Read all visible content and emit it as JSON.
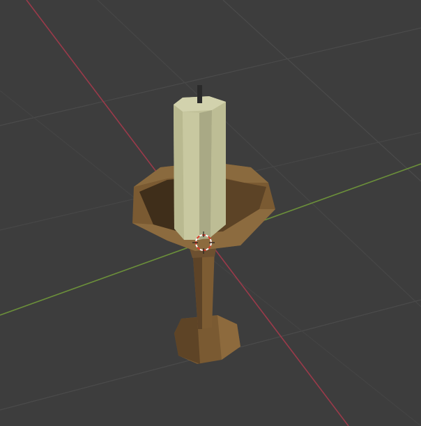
{
  "viewport": {
    "shading": "solid",
    "background_color": "#3d3d3d",
    "grid_color": "#4a4a4a",
    "x_axis_color": "#9b3a4a",
    "y_axis_color": "#6b8f3a"
  },
  "scene": {
    "objects": [
      {
        "name": "candle",
        "color": "#c8c8a0"
      },
      {
        "name": "wick",
        "color": "#2a2a2a"
      },
      {
        "name": "candle-holder",
        "color": "#7a5a32"
      }
    ],
    "cursor_icon": "3d-cursor-icon"
  }
}
